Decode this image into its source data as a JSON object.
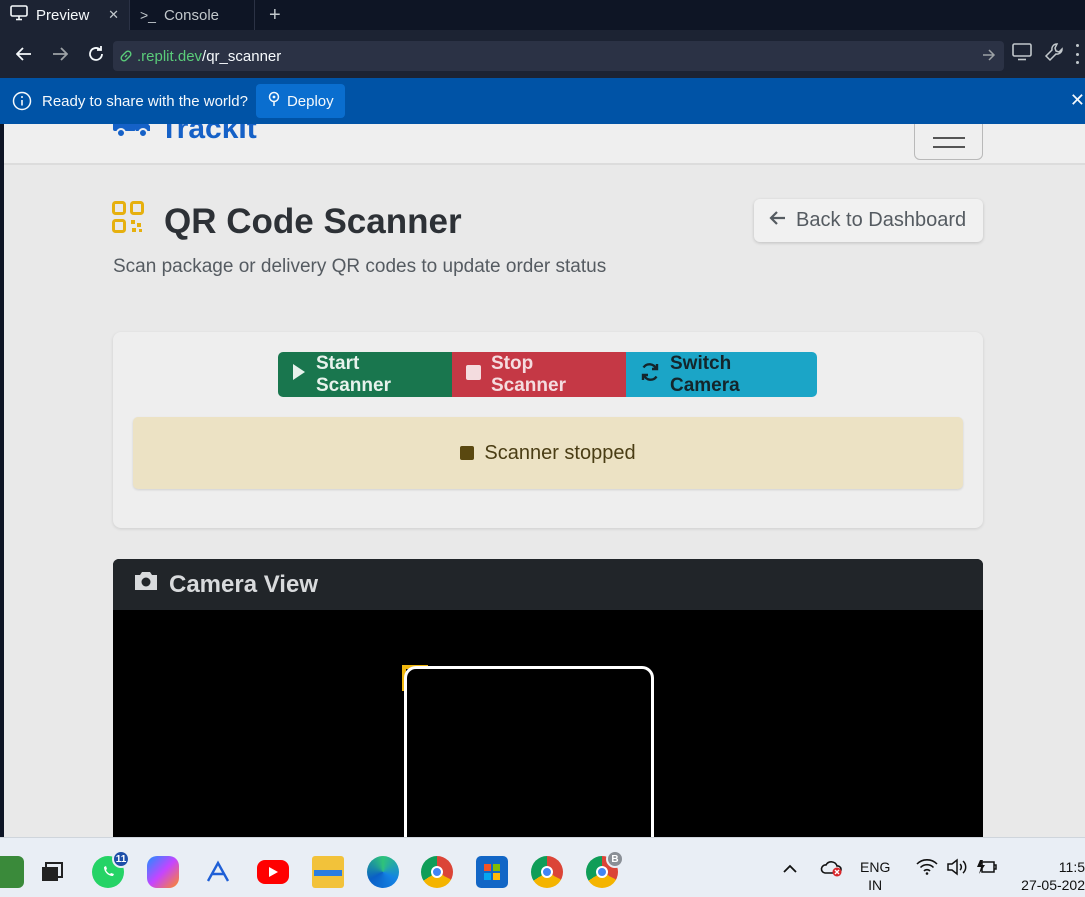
{
  "tabs": [
    {
      "label": "Preview",
      "active": true
    },
    {
      "label": "Console",
      "active": false
    }
  ],
  "urlbar": {
    "host": ".replit.dev",
    "path": "/qr_scanner"
  },
  "banner": {
    "message": "Ready to share with the world?",
    "deploy_label": "Deploy"
  },
  "app": {
    "brand": "TrackIt",
    "page_title": "QR Code Scanner",
    "page_subtitle": "Scan package or delivery QR codes to update order status",
    "back_label": "Back to Dashboard",
    "buttons": {
      "start": "Start Scanner",
      "stop": "Stop Scanner",
      "switch": "Switch Camera"
    },
    "status": "Scanner stopped",
    "camera_title": "Camera View"
  },
  "taskbar": {
    "whatsapp_badge": "11",
    "profile_badge": "B",
    "lang_line1": "ENG",
    "lang_line2": "IN",
    "time": "11:5",
    "date": "27-05-202"
  },
  "colors": {
    "start": "#19764e",
    "stop": "#c53845",
    "switch": "#1ba5c7",
    "brand": "#1561c7",
    "banner": "#0053a6"
  }
}
